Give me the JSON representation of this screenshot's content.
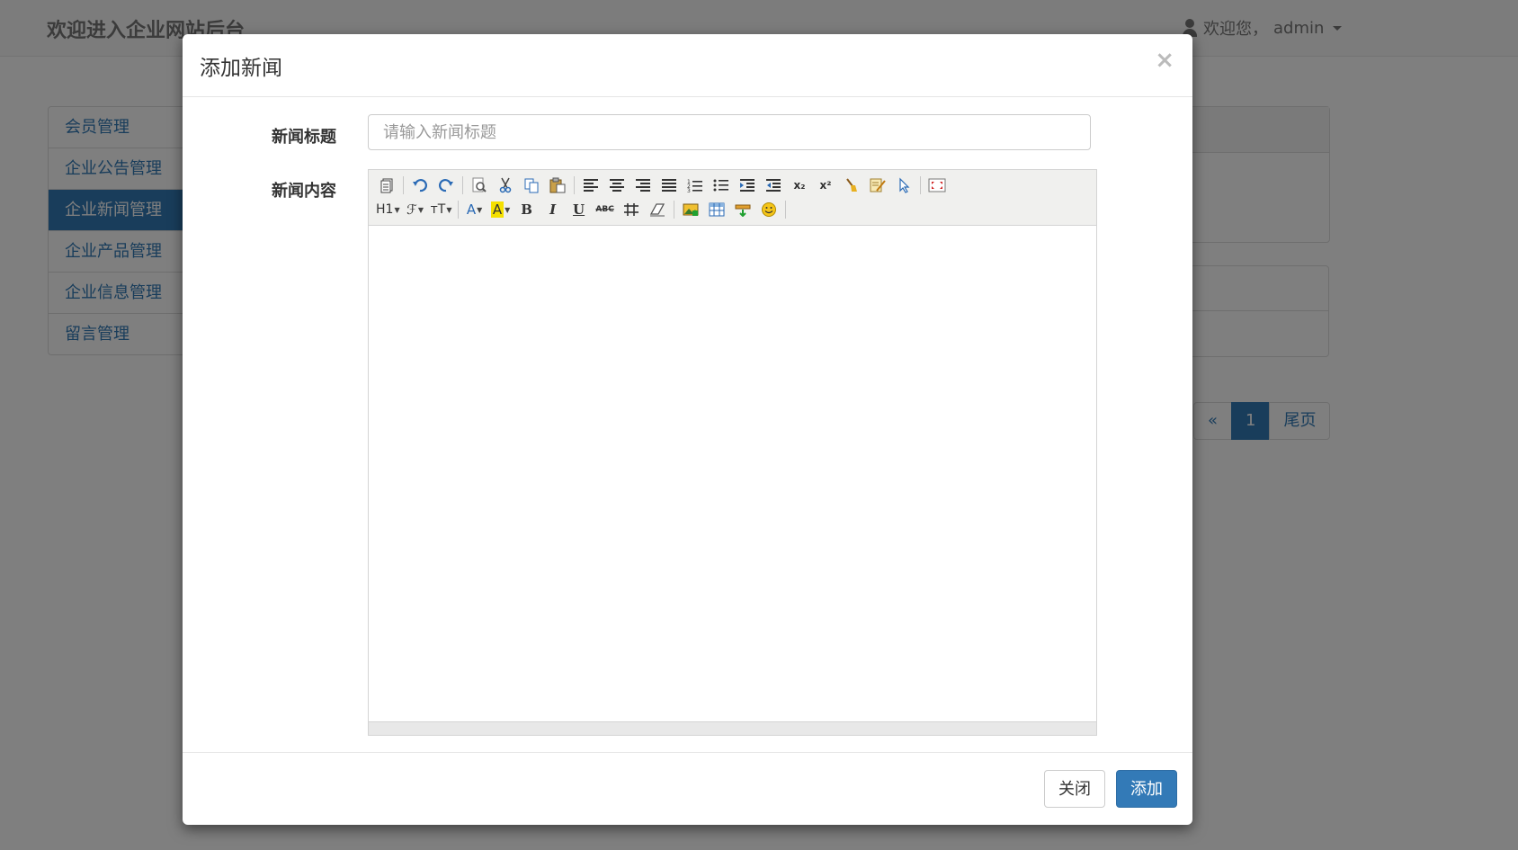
{
  "navbar": {
    "brand": "欢迎进入企业网站后台",
    "user_greeting": "欢迎您，",
    "user_name": "admin"
  },
  "sidebar": {
    "items": [
      {
        "label": "会员管理",
        "active": false
      },
      {
        "label": "企业公告管理",
        "active": false
      },
      {
        "label": "企业新闻管理",
        "active": true
      },
      {
        "label": "企业产品管理",
        "active": false
      },
      {
        "label": "企业信息管理",
        "active": false
      },
      {
        "label": "留言管理",
        "active": false
      }
    ]
  },
  "pagination": {
    "prev": "«",
    "current": "1",
    "last": "尾页"
  },
  "modal": {
    "title": "添加新闻",
    "close_symbol": "×",
    "title_label": "新闻标题",
    "title_placeholder": "请输入新闻标题",
    "title_value": "",
    "content_label": "新闻内容",
    "close_button": "关闭",
    "submit_button": "添加"
  },
  "editor": {
    "toolbar_row1": [
      "source-icon",
      "undo-icon",
      "redo-icon",
      "preview-icon",
      "cut-icon",
      "copy-icon",
      "paste-icon",
      "align-left-icon",
      "align-center-icon",
      "align-right-icon",
      "align-justify-icon",
      "ordered-list-icon",
      "unordered-list-icon",
      "indent-icon",
      "outdent-icon",
      "subscript-icon",
      "superscript-icon",
      "clear-html-icon",
      "quick-format-icon",
      "select-all-icon",
      "fullscreen-icon"
    ],
    "toolbar_row2": [
      "heading-icon",
      "font-name-icon",
      "font-size-icon",
      "fore-color-icon",
      "hilite-color-icon",
      "bold-icon",
      "italic-icon",
      "underline-icon",
      "strikethrough-icon",
      "line-height-icon",
      "remove-format-icon",
      "image-icon",
      "table-icon",
      "horizontal-rule-icon",
      "emoticon-icon"
    ],
    "labels": {
      "heading": "H1",
      "font_name": "ℱ",
      "font_size": "тT",
      "fore_color": "A",
      "hilite_color": "A",
      "bold": "B",
      "italic": "I",
      "underline": "U",
      "strikethrough": "ABC",
      "subscript": "x₂",
      "superscript": "x²"
    },
    "content": ""
  },
  "colors": {
    "primary": "#337ab7",
    "backdrop": "rgba(0,0,0,0.5)",
    "toolbar_bg": "#f0f0ee"
  }
}
